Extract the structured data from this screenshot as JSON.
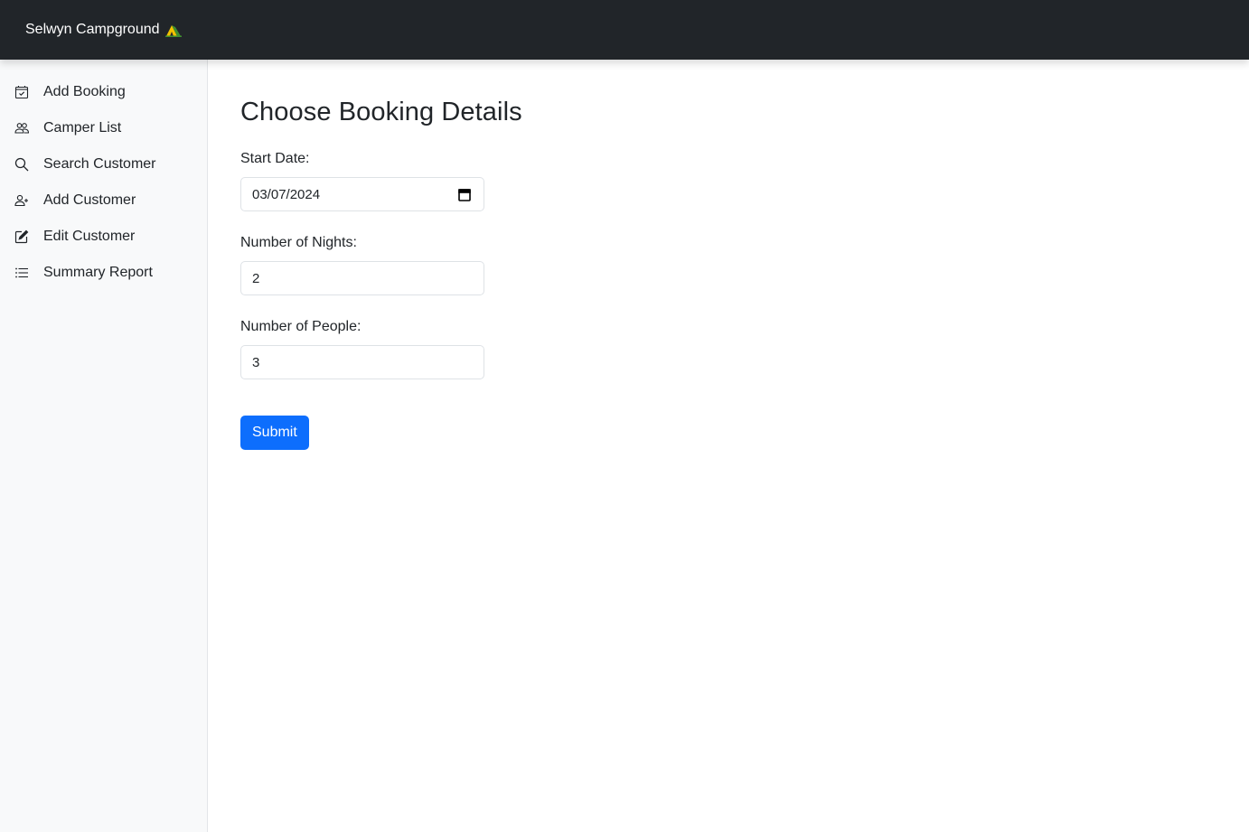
{
  "navbar": {
    "brand": "Selwyn Campground"
  },
  "sidebar": {
    "items": [
      {
        "label": "Add Booking",
        "icon": "calendar-check-icon"
      },
      {
        "label": "Camper List",
        "icon": "people-icon"
      },
      {
        "label": "Search Customer",
        "icon": "search-icon"
      },
      {
        "label": "Add Customer",
        "icon": "person-add-icon"
      },
      {
        "label": "Edit Customer",
        "icon": "edit-icon"
      },
      {
        "label": "Summary Report",
        "icon": "list-icon"
      }
    ]
  },
  "main": {
    "title": "Choose Booking Details",
    "start_date": {
      "label": "Start Date:",
      "value": "03/07/2024"
    },
    "nights": {
      "label": "Number of Nights:",
      "value": "2"
    },
    "people": {
      "label": "Number of People:",
      "value": "3"
    },
    "submit_label": "Submit"
  },
  "colors": {
    "navbar_bg": "#212529",
    "sidebar_bg": "#f8f9fa",
    "primary": "#0d6efd"
  }
}
